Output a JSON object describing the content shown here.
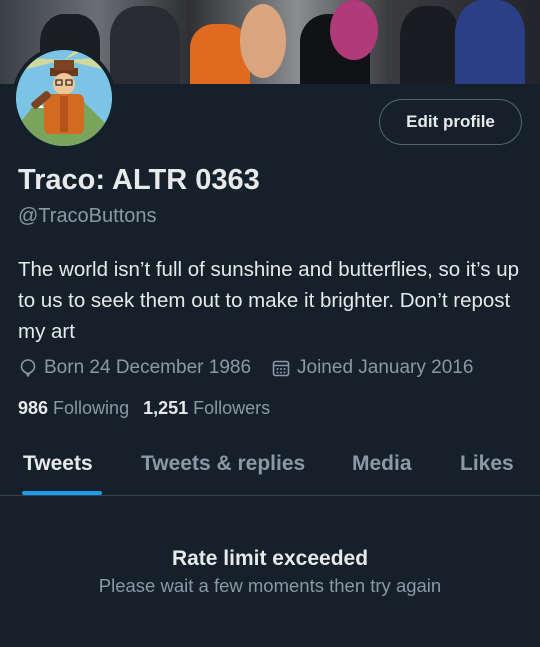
{
  "profile": {
    "display_name": "Traco: ALTR 0363",
    "handle": "@TracoButtons",
    "bio": "The world isn’t full of sunshine and butterflies, so it’s up to us to seek them out to make it brighter. Don’t repost my art",
    "born": "Born 24 December 1986",
    "joined": "Joined January 2016",
    "following_count": "986",
    "following_label": "Following",
    "followers_count": "1,251",
    "followers_label": "Followers"
  },
  "actions": {
    "edit_profile_label": "Edit profile"
  },
  "tabs": [
    {
      "label": "Tweets",
      "active": true
    },
    {
      "label": "Tweets & replies",
      "active": false
    },
    {
      "label": "Media",
      "active": false
    },
    {
      "label": "Likes",
      "active": false
    }
  ],
  "feed": {
    "error_title": "Rate limit exceeded",
    "error_message": "Please wait a few moments then try again"
  },
  "icons": {
    "born": "balloon-icon",
    "joined": "calendar-icon"
  },
  "colors": {
    "background": "#15202b",
    "accent": "#1d9bf0",
    "secondary_text": "#8b98a5"
  }
}
